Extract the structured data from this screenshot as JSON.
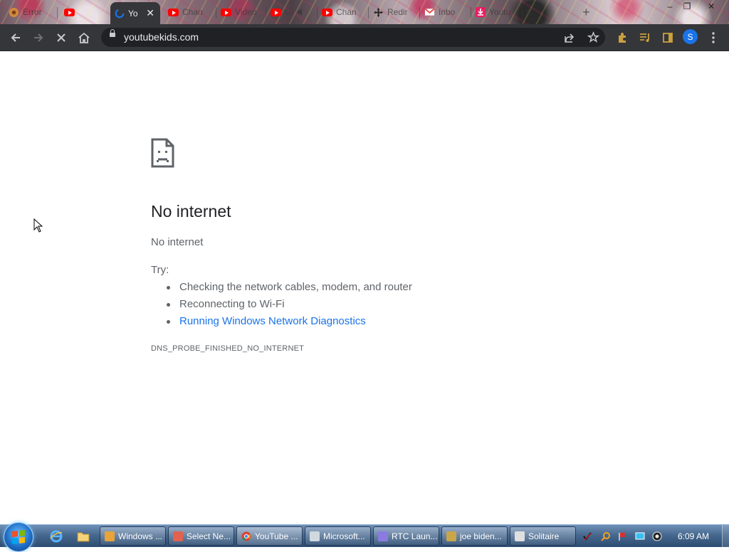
{
  "browser": {
    "tabs": [
      {
        "label": "Error",
        "favicon": "error-globe-icon"
      },
      {
        "label": "Yo",
        "favicon": "loading-icon",
        "active": true
      },
      {
        "label": "Chan",
        "favicon": "youtube-icon"
      },
      {
        "label": "Video",
        "favicon": "youtube-icon"
      },
      {
        "label": "Gi",
        "favicon": "youtube-icon"
      },
      {
        "label": "Chan",
        "favicon": "youtube-icon"
      },
      {
        "label": "Redir",
        "favicon": "move-icon"
      },
      {
        "label": "Inbo",
        "favicon": "gmail-icon"
      },
      {
        "label": "Youtu",
        "favicon": "download-icon"
      },
      {
        "label": "C",
        "favicon": "tab-icon"
      }
    ],
    "tab_close_symbol": "✕",
    "new_tab_symbol": "+",
    "window_controls": {
      "minimize": "–",
      "restore": "❐",
      "close": "✕"
    },
    "address_bar": {
      "url": "youtubekids.com"
    },
    "profile_initial": "S"
  },
  "error_page": {
    "title": "No internet",
    "subtitle": "No internet",
    "try_label": "Try:",
    "suggestions": [
      "Checking the network cables, modem, and router",
      "Reconnecting to Wi-Fi",
      "Running Windows Network Diagnostics"
    ],
    "error_code": "DNS_PROBE_FINISHED_NO_INTERNET"
  },
  "taskbar": {
    "buttons": [
      {
        "label": "Windows ...",
        "icon": "media-player-icon",
        "color": "#e8a33a"
      },
      {
        "label": "Select Ne...",
        "icon": "paint-icon",
        "color": "#e2624f"
      },
      {
        "label": "YouTube ...",
        "icon": "chrome-icon",
        "color": "#4caf50"
      },
      {
        "label": "Microsoft...",
        "icon": "window-icon",
        "color": "#d0d8e0"
      },
      {
        "label": "RTC Laun...",
        "icon": "rocket-icon",
        "color": "#8a7be0"
      },
      {
        "label": "joe biden...",
        "icon": "search-app-icon",
        "color": "#c9a64a"
      },
      {
        "label": "Solitaire",
        "icon": "cards-icon",
        "color": "#e0e0e0"
      }
    ],
    "clock": "6:09 AM"
  },
  "colors": {
    "chrome_dark": "#35363a",
    "omnibox": "#202124",
    "link": "#1a73e8",
    "text_secondary": "#5f6368",
    "taskbar": "#3a5a82"
  }
}
